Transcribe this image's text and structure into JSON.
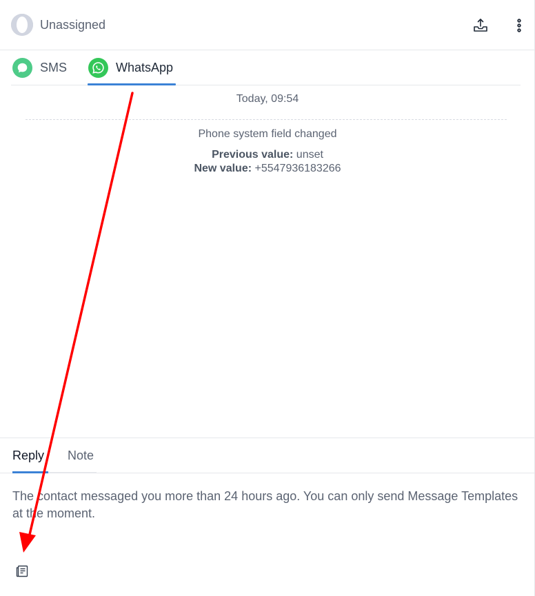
{
  "header": {
    "assignee_label": "Unassigned",
    "icons": [
      "avatar-placeholder",
      "export-icon",
      "more-vertical-icon"
    ]
  },
  "channel_tabs": [
    {
      "label": "SMS",
      "icon": "sms-chat-icon",
      "color": "#4ecb88",
      "active": false
    },
    {
      "label": "WhatsApp",
      "icon": "whatsapp-icon",
      "color": "#34c759",
      "active": true
    }
  ],
  "timeline": {
    "date_label": "Today, 09:54",
    "event": {
      "title": "Phone system field changed",
      "previous_label": "Previous value:",
      "previous_value": "unset",
      "new_label": "New value:",
      "new_value": "+5547936183266"
    }
  },
  "composer": {
    "tabs": [
      {
        "label": "Reply",
        "active": true
      },
      {
        "label": "Note",
        "active": false
      }
    ],
    "notice": "The contact messaged you more than 24 hours ago. You can only send Message Templates at the moment.",
    "toolbar_icon": "message-template-icon"
  },
  "colors": {
    "accent": "#3b82d6",
    "annotation_arrow": "#ff0000"
  }
}
